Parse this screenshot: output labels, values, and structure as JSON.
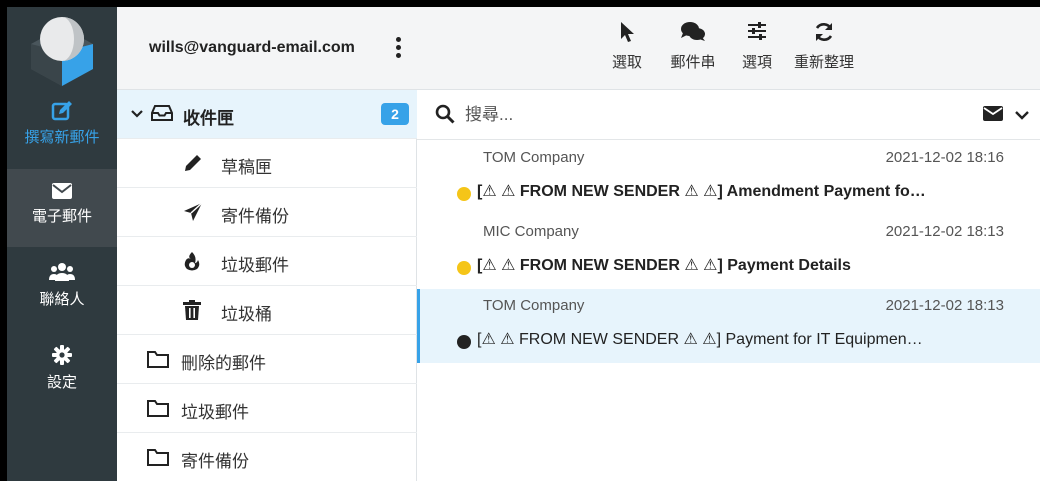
{
  "sidebar": {
    "compose": "撰寫新郵件",
    "mail": "電子郵件",
    "contacts": "聯絡人",
    "settings": "設定",
    "accent_color": "#37a2e8"
  },
  "account": {
    "email": "wills@vanguard-email.com"
  },
  "folders": {
    "items": [
      {
        "label": "收件匣",
        "badge": "2",
        "icon": "inbox-icon"
      },
      {
        "label": "草稿匣",
        "icon": "pencil-icon"
      },
      {
        "label": "寄件備份",
        "icon": "paper-plane-icon"
      },
      {
        "label": "垃圾郵件",
        "icon": "fire-icon"
      },
      {
        "label": "垃圾桶",
        "icon": "trash-icon"
      },
      {
        "label": "刪除的郵件",
        "icon": "folder-icon"
      },
      {
        "label": "垃圾郵件",
        "icon": "folder-icon"
      },
      {
        "label": "寄件備份",
        "icon": "folder-icon"
      }
    ]
  },
  "toolbar": {
    "select": "選取",
    "thread": "郵件串",
    "options": "選項",
    "refresh": "重新整理"
  },
  "search": {
    "placeholder": "搜尋..."
  },
  "messages": [
    {
      "sender": "TOM Company",
      "date": "2021-12-02 18:16",
      "subject": "[⚠ ⚠ FROM NEW SENDER ⚠ ⚠] Amendment Payment fo…",
      "unread": true,
      "dot_color": "#f5c518"
    },
    {
      "sender": "MIC Company",
      "date": "2021-12-02 18:13",
      "subject": "[⚠ ⚠ FROM NEW SENDER ⚠ ⚠] Payment Details",
      "unread": true,
      "dot_color": "#f5c518"
    },
    {
      "sender": "TOM Company",
      "date": "2021-12-02 18:13",
      "subject": "[⚠ ⚠ FROM NEW SENDER ⚠ ⚠] Payment for IT Equipmen…",
      "unread": false,
      "dot_color": "#222222"
    }
  ]
}
